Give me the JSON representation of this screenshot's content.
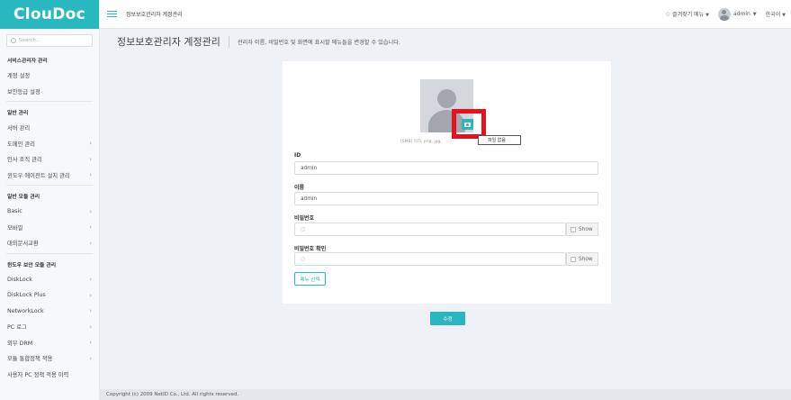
{
  "logo": {
    "text": "ClouDoc"
  },
  "search": {
    "placeholder": "Search..."
  },
  "sidebar": {
    "groups": [
      {
        "title": "서비스관리자 관리",
        "items": [
          {
            "label": "계정 설정",
            "chevron": false
          },
          {
            "label": "보안등급 설정",
            "chevron": false
          }
        ]
      },
      {
        "title": "일반 관리",
        "items": [
          {
            "label": "서버 관리",
            "chevron": false
          },
          {
            "label": "도메인 관리",
            "chevron": true
          },
          {
            "label": "인사 조직 관리",
            "chevron": true
          },
          {
            "label": "윈도우 에이전트 설치 관리",
            "chevron": true
          }
        ]
      },
      {
        "title": "일반 모듈 관리",
        "items": [
          {
            "label": "Basic",
            "chevron": true
          },
          {
            "label": "모바일",
            "chevron": true
          },
          {
            "label": "대외문서교환",
            "chevron": true
          }
        ]
      },
      {
        "title": "윈도우 보안 모듈 관리",
        "items": [
          {
            "label": "DiskLock",
            "chevron": true
          },
          {
            "label": "DiskLock Plus",
            "chevron": true
          },
          {
            "label": "NetworkLock",
            "chevron": true
          },
          {
            "label": "PC 로그",
            "chevron": true
          },
          {
            "label": "외부 DRM",
            "chevron": true
          },
          {
            "label": "모듈 통합정책 적용",
            "chevron": true
          },
          {
            "label": "사용자 PC 정책 적용 이력",
            "chevron": false
          }
        ]
      }
    ]
  },
  "topbar": {
    "title": "정보보호관리자 계정관리",
    "favorites": "즐겨찾기 메뉴",
    "user": "admin",
    "language": "한국어"
  },
  "page": {
    "title": "정보보호관리자 계정관리",
    "description": "관리자 이름, 비밀번호 및 화면에 표시할 메뉴들을 변경할 수 있습니다."
  },
  "form": {
    "file_hint": "[SMB] 이하, png, jpg,",
    "file_button": "파일 없음",
    "id_label": "ID",
    "id_value": "admin",
    "name_label": "이름",
    "name_value": "admin",
    "password_label": "비밀번호",
    "password_confirm_label": "비밀번호 확인",
    "show_label": "Show",
    "menu_select_label": "메뉴 선택"
  },
  "submit_label": "수정",
  "footer": {
    "text": "Copyright (c) 2009 NetID Co., Ltd. All rights reserved."
  },
  "colors": {
    "brand": "#29b8c0",
    "highlight": "#e8101e"
  }
}
